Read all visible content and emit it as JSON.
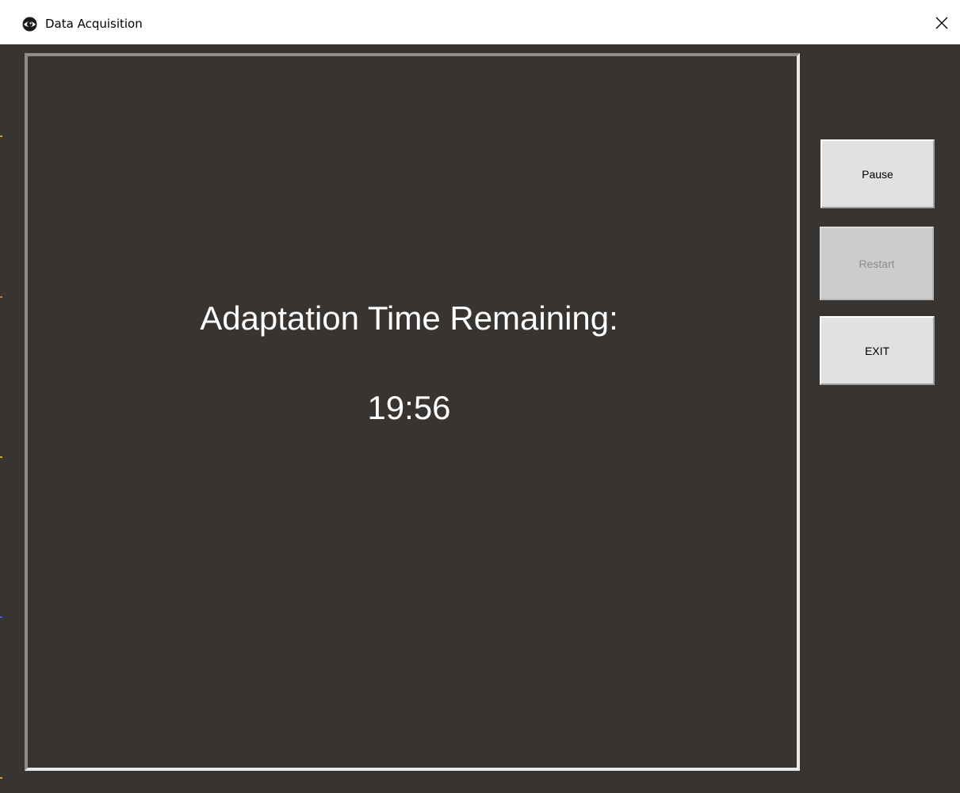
{
  "window": {
    "title": "Data Acquisition",
    "close_symbol": "✕",
    "app_icon": "eye-icon"
  },
  "display": {
    "label": "Adaptation Time Remaining:",
    "time_remaining": "19:56"
  },
  "controls": {
    "pause_label": "Pause",
    "restart_label": "Restart",
    "restart_enabled": false,
    "exit_label": "EXIT"
  },
  "colors": {
    "background": "#383431",
    "text": "#ffffff",
    "button_face": "#e1e1e1",
    "button_disabled": "#cccccc",
    "disabled_text": "#8c8c8c"
  }
}
